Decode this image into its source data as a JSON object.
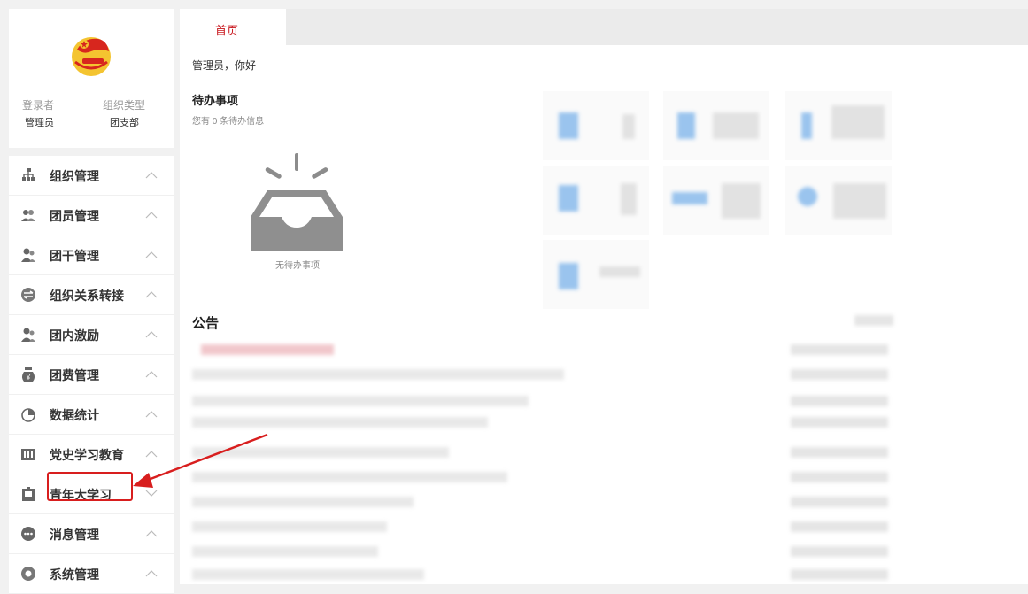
{
  "profile": {
    "login_label": "登录者",
    "login_value": "管理员",
    "org_type_label": "组织类型",
    "org_type_value": "团支部"
  },
  "menu": [
    {
      "label": "组织管理",
      "icon": "org-chart-icon",
      "chevron": "up"
    },
    {
      "label": "团员管理",
      "icon": "members-icon",
      "chevron": "up"
    },
    {
      "label": "团干管理",
      "icon": "cadres-icon",
      "chevron": "up"
    },
    {
      "label": "组织关系转接",
      "icon": "transfer-icon",
      "chevron": "up"
    },
    {
      "label": "团内激励",
      "icon": "incentive-icon",
      "chevron": "up"
    },
    {
      "label": "团费管理",
      "icon": "money-bag-icon",
      "chevron": "up"
    },
    {
      "label": "数据统计",
      "icon": "pie-chart-icon",
      "chevron": "up"
    },
    {
      "label": "党史学习教育",
      "icon": "book-icon",
      "chevron": "up"
    },
    {
      "label": "青年大学习",
      "icon": "study-icon",
      "chevron": "down"
    },
    {
      "label": "消息管理",
      "icon": "message-icon",
      "chevron": "up"
    },
    {
      "label": "系统管理",
      "icon": "gear-icon",
      "chevron": "up"
    }
  ],
  "tabs": {
    "home": "首页"
  },
  "main": {
    "greeting": "管理员，你好",
    "todo_title": "待办事项",
    "todo_subtitle": "您有 0 条待办信息",
    "empty_text": "无待办事项",
    "notice_title": "公告"
  },
  "colors": {
    "accent": "#c8161d",
    "highlight": "#d81e1e"
  }
}
